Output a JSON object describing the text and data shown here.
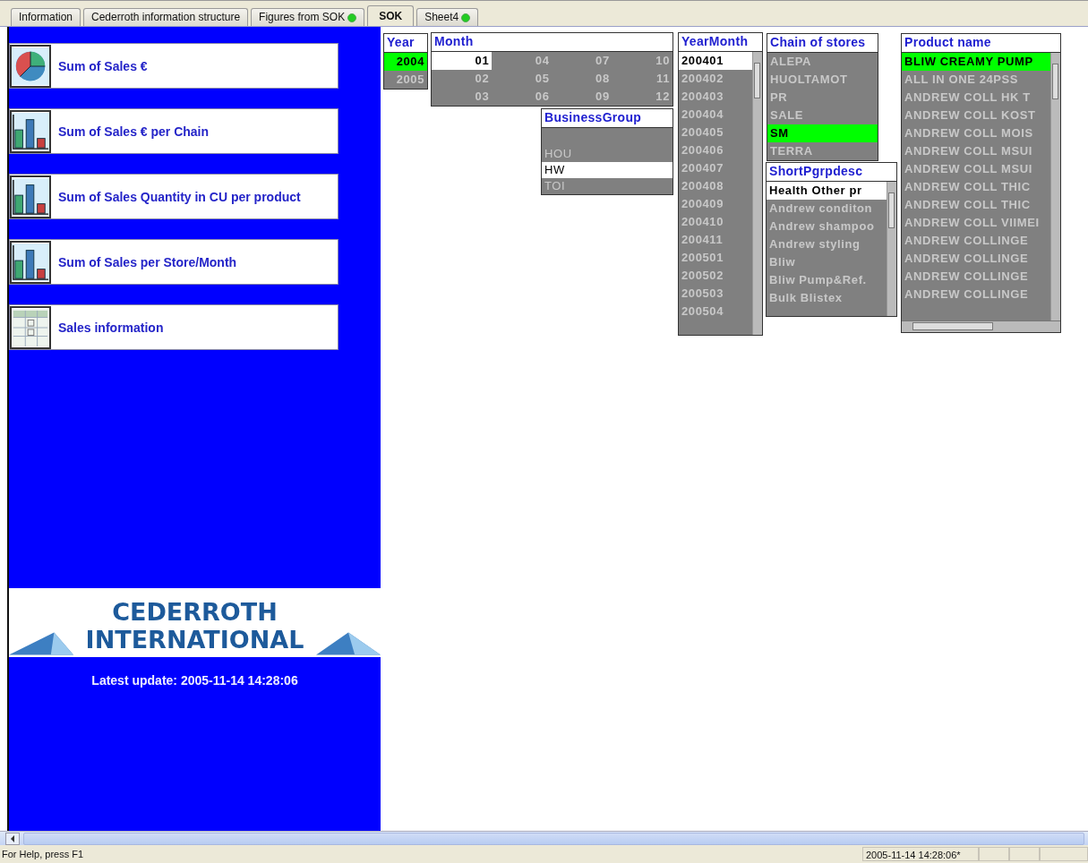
{
  "tabs": [
    {
      "label": "Information",
      "selected": false,
      "indicator": false
    },
    {
      "label": "Cederroth information structure",
      "selected": false,
      "indicator": false
    },
    {
      "label": "Figures from SOK",
      "selected": false,
      "indicator": true
    },
    {
      "label": "SOK",
      "selected": true,
      "indicator": false
    },
    {
      "label": "Sheet4",
      "selected": false,
      "indicator": true
    }
  ],
  "sidebar": {
    "buttons": [
      {
        "label": "Sum of Sales €",
        "kind": "pie"
      },
      {
        "label": "Sum of Sales € per Chain",
        "kind": "bar"
      },
      {
        "label": "Sum of Sales Quantity in CU per product",
        "kind": "bar"
      },
      {
        "label": "Sum of Sales per Store/Month",
        "kind": "bar"
      },
      {
        "label": "Sales information",
        "kind": "table"
      }
    ],
    "logo": {
      "line_1": "CEDERROTH",
      "line_2": "INTERNATIONAL"
    },
    "latest_update": "Latest update: 2005-11-14 14:28:06"
  },
  "list_boxes": [
    {
      "title": "Year",
      "kind": "list",
      "items": [
        {
          "text": "2004",
          "selected": true,
          "excluded": false
        },
        {
          "text": "2005",
          "selected": false,
          "excluded": true
        }
      ]
    },
    {
      "title": "Month",
      "kind": "grid",
      "items": [
        {
          "text": "01",
          "selected": false,
          "excluded": false
        },
        {
          "text": "02",
          "selected": false,
          "excluded": true
        },
        {
          "text": "03",
          "selected": false,
          "excluded": true
        },
        {
          "text": "04",
          "selected": false,
          "excluded": true
        },
        {
          "text": "05",
          "selected": false,
          "excluded": true
        },
        {
          "text": "06",
          "selected": false,
          "excluded": true
        },
        {
          "text": "07",
          "selected": false,
          "excluded": true
        },
        {
          "text": "08",
          "selected": false,
          "excluded": true
        },
        {
          "text": "09",
          "selected": false,
          "excluded": true
        },
        {
          "text": "10",
          "selected": false,
          "excluded": true
        },
        {
          "text": "11",
          "selected": false,
          "excluded": true
        },
        {
          "text": "12",
          "selected": false,
          "excluded": true
        }
      ]
    },
    {
      "title": "BusinessGroup",
      "kind": "list",
      "items": [
        {
          "text": "HOU",
          "selected": false,
          "excluded": true
        },
        {
          "text": "HW",
          "selected": false,
          "excluded": false
        },
        {
          "text": "TOI",
          "selected": false,
          "excluded": true
        }
      ]
    },
    {
      "title": "YearMonth",
      "kind": "list",
      "items": [
        {
          "text": "200401",
          "selected": false,
          "excluded": false
        },
        {
          "text": "200402",
          "selected": false,
          "excluded": true
        },
        {
          "text": "200403",
          "selected": false,
          "excluded": true
        },
        {
          "text": "200404",
          "selected": false,
          "excluded": true
        },
        {
          "text": "200405",
          "selected": false,
          "excluded": true
        },
        {
          "text": "200406",
          "selected": false,
          "excluded": true
        },
        {
          "text": "200407",
          "selected": false,
          "excluded": true
        },
        {
          "text": "200408",
          "selected": false,
          "excluded": true
        },
        {
          "text": "200409",
          "selected": false,
          "excluded": true
        },
        {
          "text": "200410",
          "selected": false,
          "excluded": true
        },
        {
          "text": "200411",
          "selected": false,
          "excluded": true
        },
        {
          "text": "200501",
          "selected": false,
          "excluded": true
        },
        {
          "text": "200502",
          "selected": false,
          "excluded": true
        },
        {
          "text": "200503",
          "selected": false,
          "excluded": true
        },
        {
          "text": "200504",
          "selected": false,
          "excluded": true
        }
      ]
    },
    {
      "title": "Chain of stores",
      "kind": "list",
      "items": [
        {
          "text": "ALEPA",
          "selected": false,
          "excluded": true
        },
        {
          "text": "HUOLTAMOT",
          "selected": false,
          "excluded": true
        },
        {
          "text": "PR",
          "selected": false,
          "excluded": true
        },
        {
          "text": "SALE",
          "selected": false,
          "excluded": true
        },
        {
          "text": "SM",
          "selected": true,
          "excluded": false
        },
        {
          "text": "TERRA",
          "selected": false,
          "excluded": true
        }
      ]
    },
    {
      "title": "ShortPgrpdesc",
      "kind": "list",
      "items": [
        {
          "text": "Health Other pr",
          "selected": false,
          "excluded": false
        },
        {
          "text": "Andrew conditon",
          "selected": false,
          "excluded": true
        },
        {
          "text": "Andrew shampoo",
          "selected": false,
          "excluded": true
        },
        {
          "text": "Andrew styling",
          "selected": false,
          "excluded": true
        },
        {
          "text": "Bliw",
          "selected": false,
          "excluded": true
        },
        {
          "text": "Bliw Pump&Ref.",
          "selected": false,
          "excluded": true
        },
        {
          "text": "Bulk Blistex",
          "selected": false,
          "excluded": true
        }
      ]
    },
    {
      "title": "Product name",
      "kind": "list",
      "items": [
        {
          "text": "BLIW CREAMY PUMP",
          "selected": true,
          "excluded": false
        },
        {
          "text": "ALL IN ONE 24PSS",
          "selected": false,
          "excluded": true
        },
        {
          "text": "ANDREW COLL HK T",
          "selected": false,
          "excluded": true
        },
        {
          "text": "ANDREW COLL KOST",
          "selected": false,
          "excluded": true
        },
        {
          "text": "ANDREW COLL MOIS",
          "selected": false,
          "excluded": true
        },
        {
          "text": "ANDREW COLL MSUI",
          "selected": false,
          "excluded": true
        },
        {
          "text": "ANDREW COLL MSUI",
          "selected": false,
          "excluded": true
        },
        {
          "text": "ANDREW COLL THIC",
          "selected": false,
          "excluded": true
        },
        {
          "text": "ANDREW COLL THIC",
          "selected": false,
          "excluded": true
        },
        {
          "text": "ANDREW COLL VIIMEI",
          "selected": false,
          "excluded": true
        },
        {
          "text": "ANDREW COLLINGE",
          "selected": false,
          "excluded": true
        },
        {
          "text": "ANDREW COLLINGE",
          "selected": false,
          "excluded": true
        },
        {
          "text": "ANDREW COLLINGE",
          "selected": false,
          "excluded": true
        },
        {
          "text": "ANDREW COLLINGE",
          "selected": false,
          "excluded": true
        }
      ]
    }
  ],
  "status_bar": {
    "help": "For Help, press F1",
    "timestamp": "2005-11-14 14:28:06*"
  }
}
